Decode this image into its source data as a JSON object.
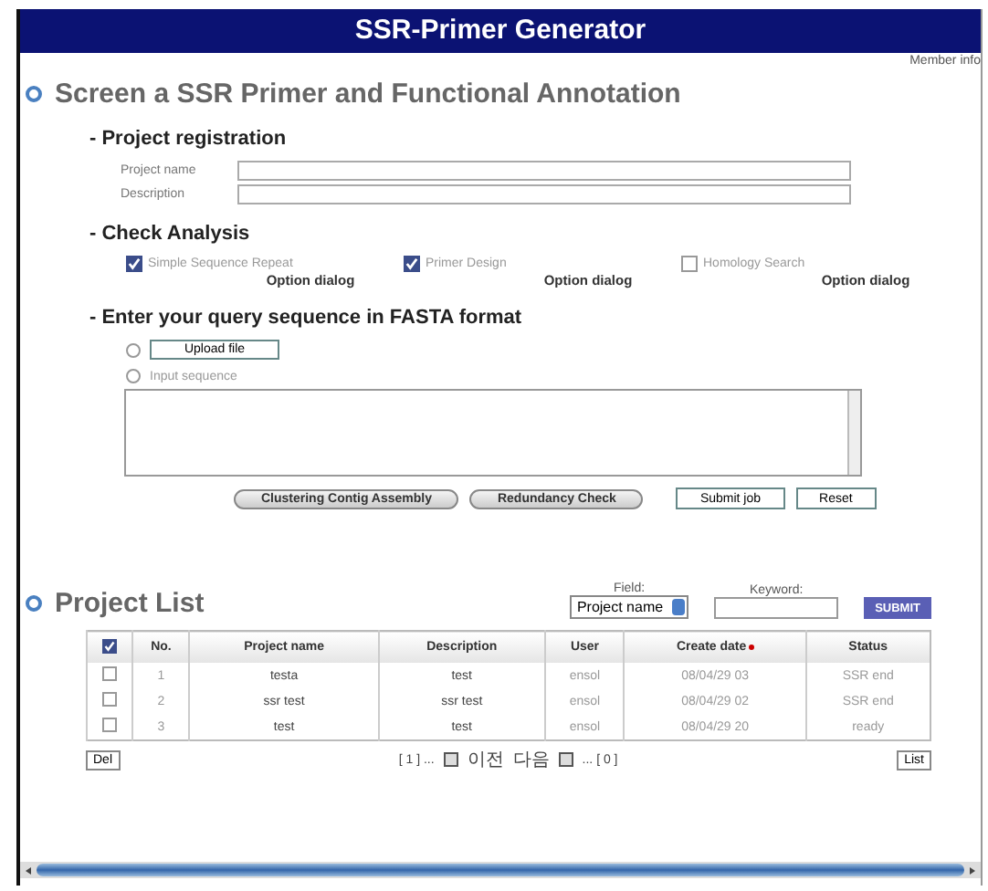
{
  "window": {
    "title": "SSR-Primer Generator"
  },
  "member_link": "Member info",
  "main_heading": "Screen a SSR Primer and Functional Annotation",
  "registration": {
    "heading": "- Project registration",
    "fields": [
      {
        "label": "Project name"
      },
      {
        "label": "Description"
      }
    ]
  },
  "analysis": {
    "heading": "- Check Analysis",
    "options": [
      {
        "label": "Simple Sequence Repeat",
        "checked": true,
        "link": "Option dialog"
      },
      {
        "label": "Primer Design",
        "checked": true,
        "link": "Option dialog"
      },
      {
        "label": "Homology Search",
        "checked": false,
        "link": "Option dialog"
      }
    ]
  },
  "query": {
    "heading": "- Enter your query sequence in FASTA format",
    "sources": [
      {
        "kind": "upload",
        "button": "Upload file",
        "selected": false
      },
      {
        "kind": "text",
        "label": "Input sequence",
        "selected": false
      }
    ]
  },
  "actions": [
    {
      "label": "Clustering Contig Assembly",
      "kind": "pill"
    },
    {
      "label": "Redundancy Check",
      "kind": "pill"
    },
    {
      "label": "Submit job",
      "kind": "box"
    },
    {
      "label": "Reset",
      "kind": "box"
    }
  ],
  "project_list": {
    "heading": "Project List",
    "field_label": "Field:",
    "field_value": "Project name",
    "keyword_label": "Keyword:",
    "submit": "SUBMIT",
    "header_checked": true,
    "columns": [
      "No.",
      "Project name",
      "Description",
      "User",
      "Create date",
      "Status"
    ],
    "rows": [
      {
        "checked": false,
        "cells": [
          "1",
          "testa",
          "test",
          "ensol",
          "08/04/29 03",
          "SSR end"
        ]
      },
      {
        "checked": false,
        "cells": [
          "2",
          "ssr test",
          "ssr test",
          "ensol",
          "08/04/29 02",
          "SSR end"
        ]
      },
      {
        "checked": false,
        "cells": [
          "3",
          "test",
          "test",
          "ensol",
          "08/04/29 20",
          "ready"
        ]
      }
    ],
    "delete_button": "Del",
    "list_button": "List",
    "pagination": {
      "first": "[ 1 ] ...",
      "prev": "이전",
      "next": "다음",
      "last": "... [ 0 ]"
    }
  }
}
